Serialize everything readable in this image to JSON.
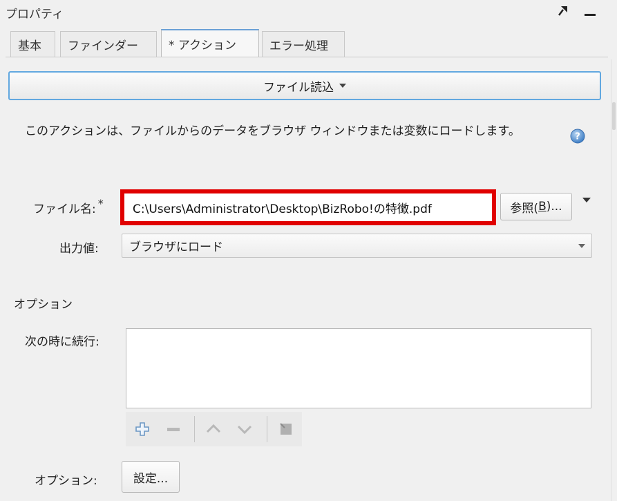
{
  "panel": {
    "title": "プロパティ",
    "icons": {
      "pin": "pin-icon",
      "minimize": "minimize-icon"
    }
  },
  "tabs": [
    {
      "label": "基本",
      "active": false
    },
    {
      "label": "ファインダー",
      "active": false
    },
    {
      "label": "* アクション",
      "active": true
    },
    {
      "label": "エラー処理",
      "active": false
    }
  ],
  "action": {
    "label": "ファイル読込"
  },
  "description": "このアクションは、ファイルからのデータをブラウザ ウィンドウまたは変数にロードします。",
  "file": {
    "label": "ファイル名:",
    "required_mark": "*",
    "value": "C:\\Users\\Administrator\\Desktop\\BizRobo!の特徴.pdf",
    "browse_label": "参照(",
    "browse_mnemonic": "B",
    "browse_suffix": ")..."
  },
  "output": {
    "label": "出力値:",
    "value": "ブラウザにロード"
  },
  "options_section": {
    "title": "オプション",
    "continue_label": "次の時に続行:"
  },
  "options_row": {
    "label": "オプション:",
    "button": "設定..."
  },
  "colors": {
    "highlight": "#e00000",
    "accent": "#62a8e0"
  }
}
